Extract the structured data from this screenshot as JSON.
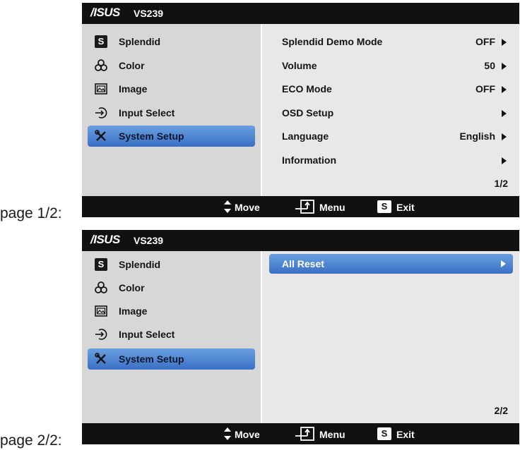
{
  "osd_pages": [
    {
      "caption": "page 1/2:",
      "brand": "/ISUS",
      "model": "VS239",
      "menu": [
        {
          "label": "Splendid",
          "icon": "splendid-s-icon"
        },
        {
          "label": "Color",
          "icon": "color-icon"
        },
        {
          "label": "Image",
          "icon": "image-icon"
        },
        {
          "label": "Input Select",
          "icon": "input-select-icon"
        },
        {
          "label": "System Setup",
          "icon": "system-setup-icon",
          "selected": true
        }
      ],
      "settings": [
        {
          "label": "Splendid Demo Mode",
          "value": "OFF"
        },
        {
          "label": "Volume",
          "value": "50"
        },
        {
          "label": "ECO Mode",
          "value": "OFF"
        },
        {
          "label": "OSD Setup",
          "value": ""
        },
        {
          "label": "Language",
          "value": "English"
        },
        {
          "label": "Information",
          "value": ""
        }
      ],
      "page_indicator": "1/2",
      "footer": {
        "move": "Move",
        "menu": "Menu",
        "exit_key": "S",
        "exit": "Exit"
      }
    },
    {
      "caption": "page 2/2:",
      "brand": "/ISUS",
      "model": "VS239",
      "menu": [
        {
          "label": "Splendid",
          "icon": "splendid-s-icon"
        },
        {
          "label": "Color",
          "icon": "color-icon"
        },
        {
          "label": "Image",
          "icon": "image-icon"
        },
        {
          "label": "Input Select",
          "icon": "input-select-icon"
        },
        {
          "label": "System Setup",
          "icon": "system-setup-icon",
          "selected": true
        }
      ],
      "settings": [
        {
          "label": "All Reset",
          "value": "",
          "selected": true
        }
      ],
      "page_indicator": "2/2",
      "footer": {
        "move": "Move",
        "menu": "Menu",
        "exit_key": "S",
        "exit": "Exit"
      }
    }
  ],
  "colors": {
    "header_bg": "#111111",
    "left_bg": "#d7d7d7",
    "right_bg": "#e8e8e8",
    "highlight": "#3a6fc4"
  }
}
